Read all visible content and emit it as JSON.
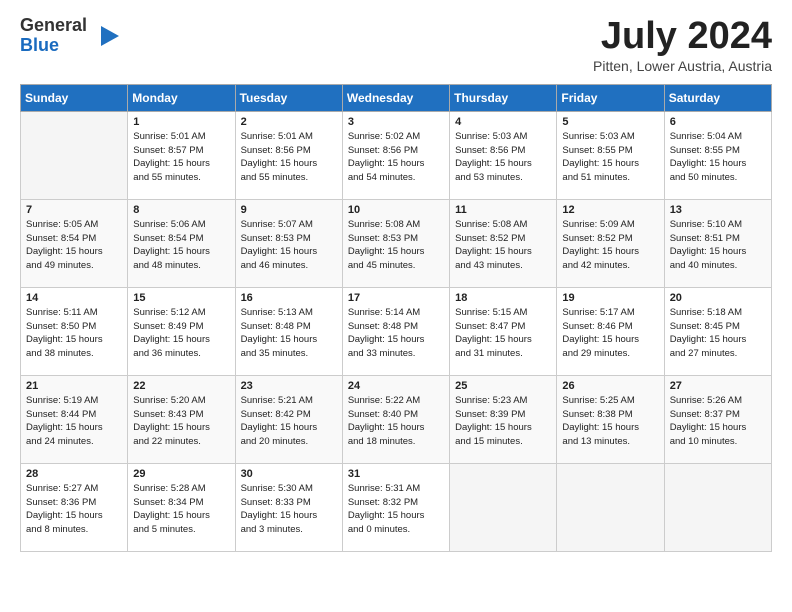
{
  "header": {
    "logo_general": "General",
    "logo_blue": "Blue",
    "month_title": "July 2024",
    "subtitle": "Pitten, Lower Austria, Austria"
  },
  "days_of_week": [
    "Sunday",
    "Monday",
    "Tuesday",
    "Wednesday",
    "Thursday",
    "Friday",
    "Saturday"
  ],
  "weeks": [
    [
      {
        "day": "",
        "info": ""
      },
      {
        "day": "1",
        "info": "Sunrise: 5:01 AM\nSunset: 8:57 PM\nDaylight: 15 hours\nand 55 minutes."
      },
      {
        "day": "2",
        "info": "Sunrise: 5:01 AM\nSunset: 8:56 PM\nDaylight: 15 hours\nand 55 minutes."
      },
      {
        "day": "3",
        "info": "Sunrise: 5:02 AM\nSunset: 8:56 PM\nDaylight: 15 hours\nand 54 minutes."
      },
      {
        "day": "4",
        "info": "Sunrise: 5:03 AM\nSunset: 8:56 PM\nDaylight: 15 hours\nand 53 minutes."
      },
      {
        "day": "5",
        "info": "Sunrise: 5:03 AM\nSunset: 8:55 PM\nDaylight: 15 hours\nand 51 minutes."
      },
      {
        "day": "6",
        "info": "Sunrise: 5:04 AM\nSunset: 8:55 PM\nDaylight: 15 hours\nand 50 minutes."
      }
    ],
    [
      {
        "day": "7",
        "info": "Sunrise: 5:05 AM\nSunset: 8:54 PM\nDaylight: 15 hours\nand 49 minutes."
      },
      {
        "day": "8",
        "info": "Sunrise: 5:06 AM\nSunset: 8:54 PM\nDaylight: 15 hours\nand 48 minutes."
      },
      {
        "day": "9",
        "info": "Sunrise: 5:07 AM\nSunset: 8:53 PM\nDaylight: 15 hours\nand 46 minutes."
      },
      {
        "day": "10",
        "info": "Sunrise: 5:08 AM\nSunset: 8:53 PM\nDaylight: 15 hours\nand 45 minutes."
      },
      {
        "day": "11",
        "info": "Sunrise: 5:08 AM\nSunset: 8:52 PM\nDaylight: 15 hours\nand 43 minutes."
      },
      {
        "day": "12",
        "info": "Sunrise: 5:09 AM\nSunset: 8:52 PM\nDaylight: 15 hours\nand 42 minutes."
      },
      {
        "day": "13",
        "info": "Sunrise: 5:10 AM\nSunset: 8:51 PM\nDaylight: 15 hours\nand 40 minutes."
      }
    ],
    [
      {
        "day": "14",
        "info": "Sunrise: 5:11 AM\nSunset: 8:50 PM\nDaylight: 15 hours\nand 38 minutes."
      },
      {
        "day": "15",
        "info": "Sunrise: 5:12 AM\nSunset: 8:49 PM\nDaylight: 15 hours\nand 36 minutes."
      },
      {
        "day": "16",
        "info": "Sunrise: 5:13 AM\nSunset: 8:48 PM\nDaylight: 15 hours\nand 35 minutes."
      },
      {
        "day": "17",
        "info": "Sunrise: 5:14 AM\nSunset: 8:48 PM\nDaylight: 15 hours\nand 33 minutes."
      },
      {
        "day": "18",
        "info": "Sunrise: 5:15 AM\nSunset: 8:47 PM\nDaylight: 15 hours\nand 31 minutes."
      },
      {
        "day": "19",
        "info": "Sunrise: 5:17 AM\nSunset: 8:46 PM\nDaylight: 15 hours\nand 29 minutes."
      },
      {
        "day": "20",
        "info": "Sunrise: 5:18 AM\nSunset: 8:45 PM\nDaylight: 15 hours\nand 27 minutes."
      }
    ],
    [
      {
        "day": "21",
        "info": "Sunrise: 5:19 AM\nSunset: 8:44 PM\nDaylight: 15 hours\nand 24 minutes."
      },
      {
        "day": "22",
        "info": "Sunrise: 5:20 AM\nSunset: 8:43 PM\nDaylight: 15 hours\nand 22 minutes."
      },
      {
        "day": "23",
        "info": "Sunrise: 5:21 AM\nSunset: 8:42 PM\nDaylight: 15 hours\nand 20 minutes."
      },
      {
        "day": "24",
        "info": "Sunrise: 5:22 AM\nSunset: 8:40 PM\nDaylight: 15 hours\nand 18 minutes."
      },
      {
        "day": "25",
        "info": "Sunrise: 5:23 AM\nSunset: 8:39 PM\nDaylight: 15 hours\nand 15 minutes."
      },
      {
        "day": "26",
        "info": "Sunrise: 5:25 AM\nSunset: 8:38 PM\nDaylight: 15 hours\nand 13 minutes."
      },
      {
        "day": "27",
        "info": "Sunrise: 5:26 AM\nSunset: 8:37 PM\nDaylight: 15 hours\nand 10 minutes."
      }
    ],
    [
      {
        "day": "28",
        "info": "Sunrise: 5:27 AM\nSunset: 8:36 PM\nDaylight: 15 hours\nand 8 minutes."
      },
      {
        "day": "29",
        "info": "Sunrise: 5:28 AM\nSunset: 8:34 PM\nDaylight: 15 hours\nand 5 minutes."
      },
      {
        "day": "30",
        "info": "Sunrise: 5:30 AM\nSunset: 8:33 PM\nDaylight: 15 hours\nand 3 minutes."
      },
      {
        "day": "31",
        "info": "Sunrise: 5:31 AM\nSunset: 8:32 PM\nDaylight: 15 hours\nand 0 minutes."
      },
      {
        "day": "",
        "info": ""
      },
      {
        "day": "",
        "info": ""
      },
      {
        "day": "",
        "info": ""
      }
    ]
  ]
}
